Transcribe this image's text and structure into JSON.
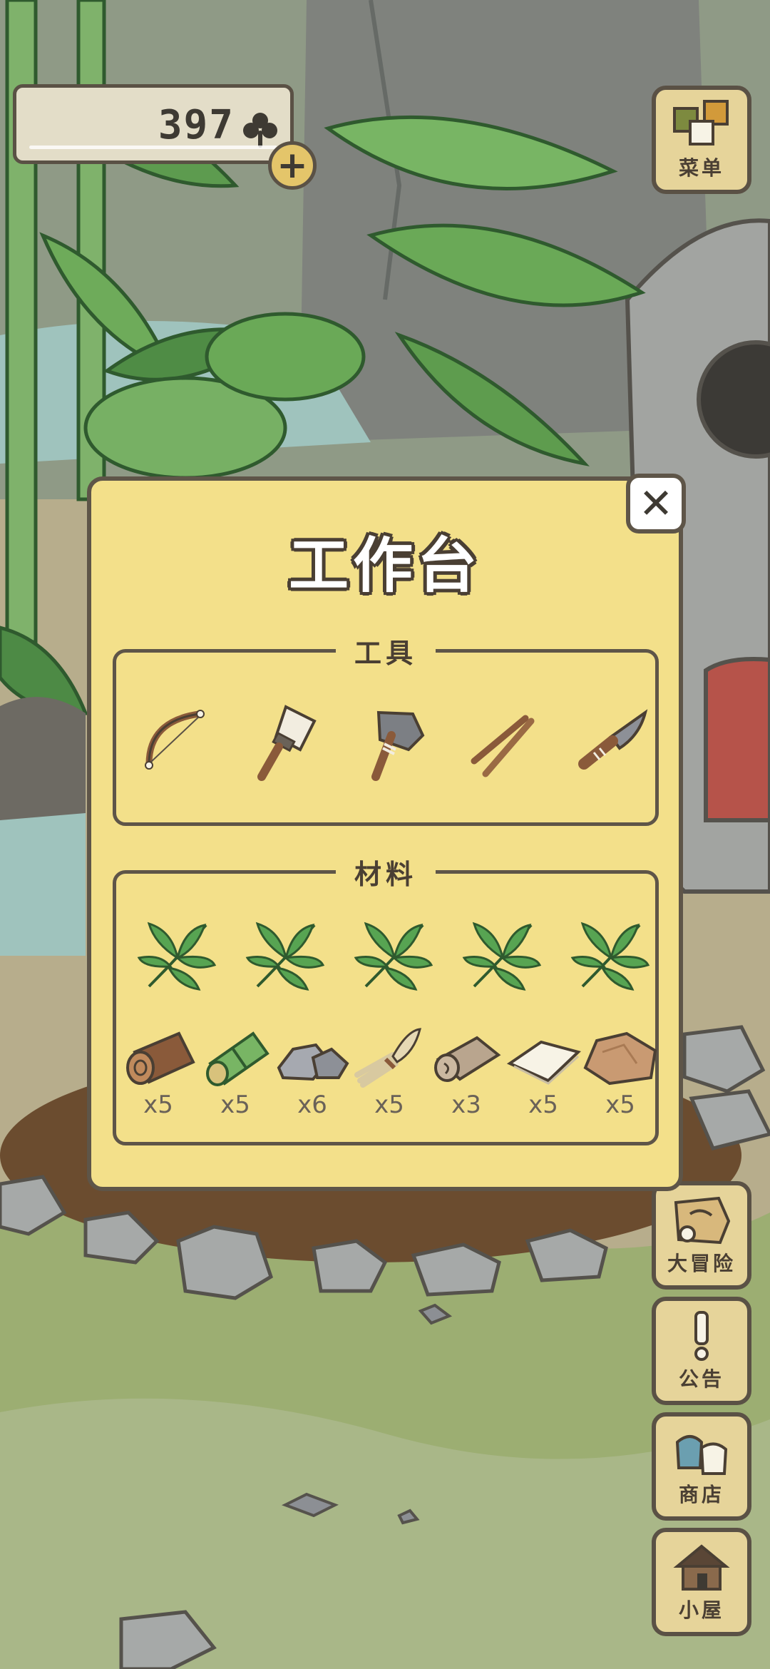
{
  "hud": {
    "clover_count": "397",
    "clover_icon": "clover-icon",
    "add_icon": "plus-icon",
    "add_label": "+"
  },
  "side_menu": {
    "menu_label": "菜单",
    "adventure_label": "大冒险",
    "notice_label": "公告",
    "shop_label": "商店",
    "hut_label": "小屋"
  },
  "workbench": {
    "title": "工作台",
    "close_label": "✕",
    "tools_title": "工具",
    "tools": [
      {
        "icon": "bow-drill-icon"
      },
      {
        "icon": "brush-icon"
      },
      {
        "icon": "stone-axe-icon"
      },
      {
        "icon": "sticks-icon"
      },
      {
        "icon": "knife-icon"
      }
    ],
    "materials_title": "材料",
    "leaves": [
      {
        "icon": "leaf-icon"
      },
      {
        "icon": "leaf-icon"
      },
      {
        "icon": "leaf-icon"
      },
      {
        "icon": "leaf-icon"
      },
      {
        "icon": "leaf-icon"
      }
    ],
    "materials": [
      {
        "icon": "wood-log-icon",
        "count": "x5"
      },
      {
        "icon": "bamboo-icon",
        "count": "x5"
      },
      {
        "icon": "stone-icon",
        "count": "x6"
      },
      {
        "icon": "fiber-bundle-icon",
        "count": "x5"
      },
      {
        "icon": "leather-roll-icon",
        "count": "x3"
      },
      {
        "icon": "cloth-icon",
        "count": "x5"
      },
      {
        "icon": "clay-rock-icon",
        "count": "x5"
      }
    ]
  },
  "colors": {
    "dialog_bg": "#f3e08a",
    "outline": "#5e5548",
    "button_bg": "#e6d49a",
    "leaf_green": "#4d9a4a"
  }
}
